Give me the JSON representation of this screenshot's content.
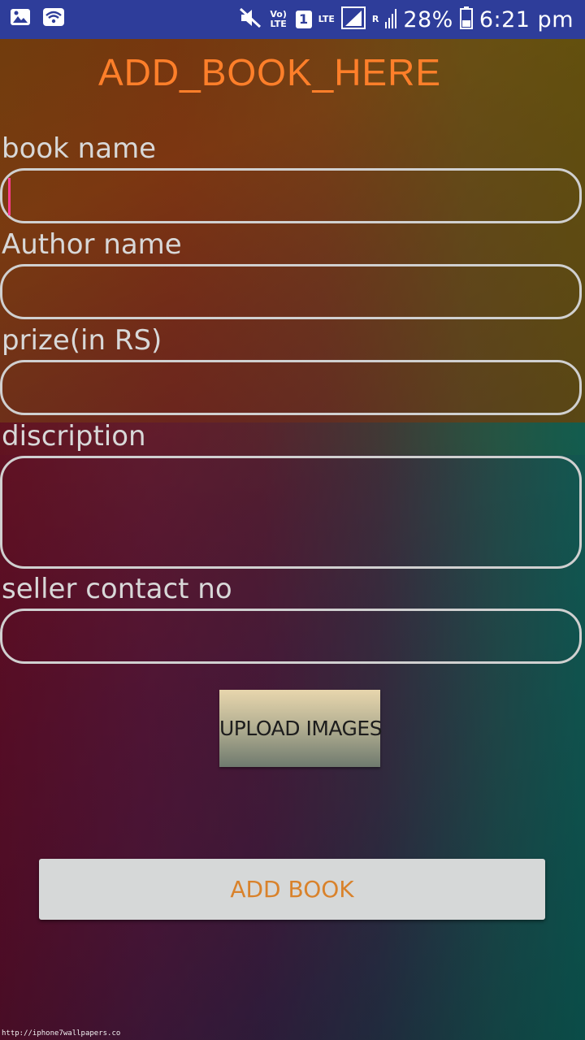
{
  "status_bar": {
    "icons_left": [
      "gallery-icon",
      "wifi-icon"
    ],
    "icons_right": [
      "mute-icon",
      "volte-icon",
      "sim-icon",
      "lte-icon",
      "signal-icon",
      "roaming-signal-icon",
      "battery-icon"
    ],
    "volte_text": "Vo) LTE",
    "sim_number": "1",
    "lte_text": "LTE",
    "roaming_text": "R",
    "battery_percent": "28%",
    "time": "6:21 pm",
    "bar_color": "#2e3d9a"
  },
  "page": {
    "title": "ADD_BOOK_HERE",
    "title_color": "#ff7f2a"
  },
  "form": {
    "book_name_label": "book name",
    "book_name_value": "",
    "author_name_label": "Author name",
    "author_name_value": "",
    "prize_label": "prize(in RS)",
    "prize_value": "",
    "description_label": "discription",
    "description_value": "",
    "seller_contact_label": "seller contact no",
    "seller_contact_value": ""
  },
  "buttons": {
    "upload_images": "UPLOAD IMAGES",
    "add_book": "ADD BOOK",
    "add_book_text_color": "#d9822b"
  },
  "watermark": "http://iphone7wallpapers.co"
}
